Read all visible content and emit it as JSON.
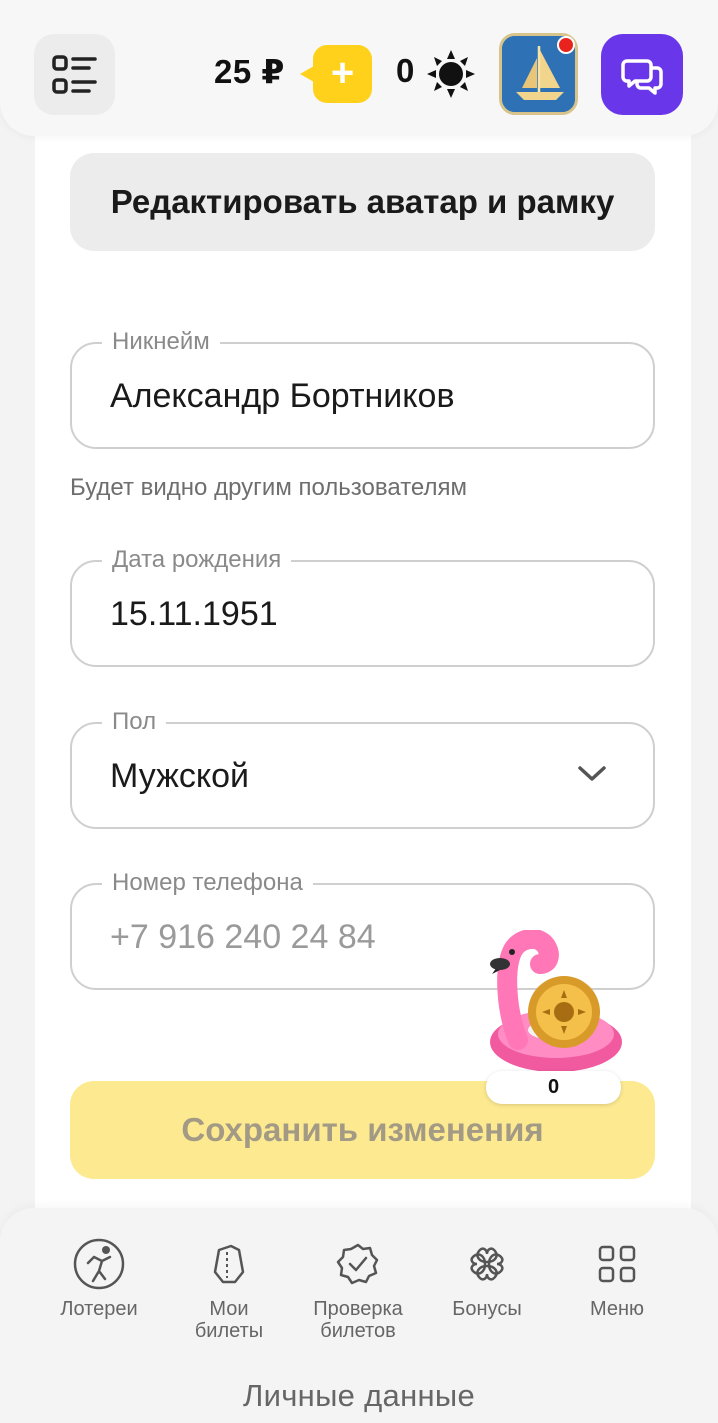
{
  "header": {
    "balance": "25 ₽",
    "topup_symbol": "+",
    "suns_count": "0",
    "colors": {
      "topup": "#ffd11a",
      "chat": "#6a36ea",
      "notification_dot": "#e8231d"
    }
  },
  "profile": {
    "edit_avatar_label": "Редактировать аватар и рамку",
    "nickname": {
      "label": "Никнейм",
      "value": "Александр Бортников",
      "hint": "Будет видно другим пользователям"
    },
    "birthdate": {
      "label": "Дата рождения",
      "value": "15.11.1951"
    },
    "gender": {
      "label": "Пол",
      "value": "Мужской"
    },
    "phone": {
      "label": "Номер телефона",
      "placeholder": "+7 916 240 24 84"
    },
    "save_label": "Сохранить изменения"
  },
  "promo": {
    "count": "0"
  },
  "nav": {
    "items": [
      {
        "label": "Лотереи",
        "icon": "lottery-player-icon"
      },
      {
        "label": "Мои\nбилеты",
        "icon": "tickets-icon"
      },
      {
        "label": "Проверка\nбилетов",
        "icon": "check-badge-icon"
      },
      {
        "label": "Бонусы",
        "icon": "bonus-clover-icon"
      },
      {
        "label": "Меню",
        "icon": "grid-menu-icon"
      }
    ]
  },
  "page_title": "Личные данные"
}
